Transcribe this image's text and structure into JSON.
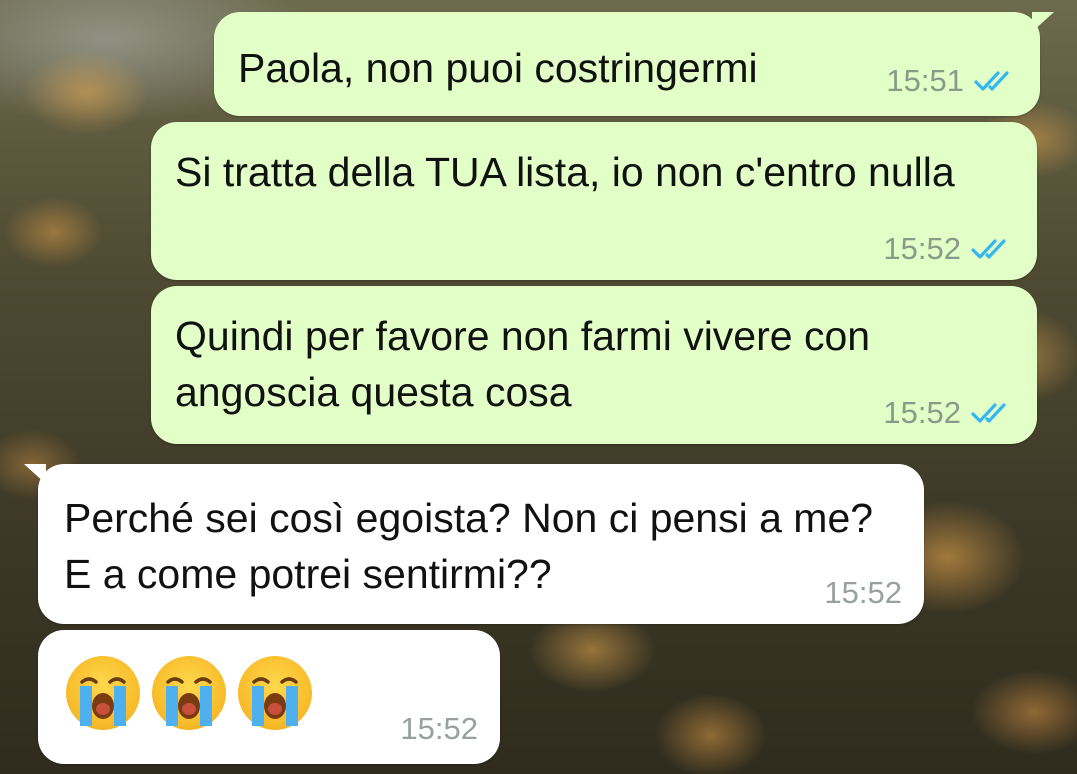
{
  "messages": [
    {
      "direction": "out",
      "text": "Paola, non puoi costringermi",
      "time": "15:51",
      "status": "read-double-check-icon"
    },
    {
      "direction": "out",
      "text": "Si tratta della TUA lista, io non c'entro nulla",
      "time": "15:52",
      "status": "read-double-check-icon"
    },
    {
      "direction": "out",
      "text": "Quindi per favore non farmi vivere con angoscia questa cosa",
      "time": "15:52",
      "status": "read-double-check-icon"
    },
    {
      "direction": "in",
      "text": "Perché sei così egoista? Non ci pensi a me? E a come potrei sentirmi??",
      "time": "15:52"
    },
    {
      "direction": "in",
      "emojis": [
        "loudly-crying-face-icon",
        "loudly-crying-face-icon",
        "loudly-crying-face-icon"
      ],
      "time": "15:52"
    }
  ],
  "colors": {
    "outgoing_bubble": "#e2ffc7",
    "incoming_bubble": "#ffffff",
    "read_tick": "#34b7f1",
    "timestamp": "#8a9a8a"
  }
}
